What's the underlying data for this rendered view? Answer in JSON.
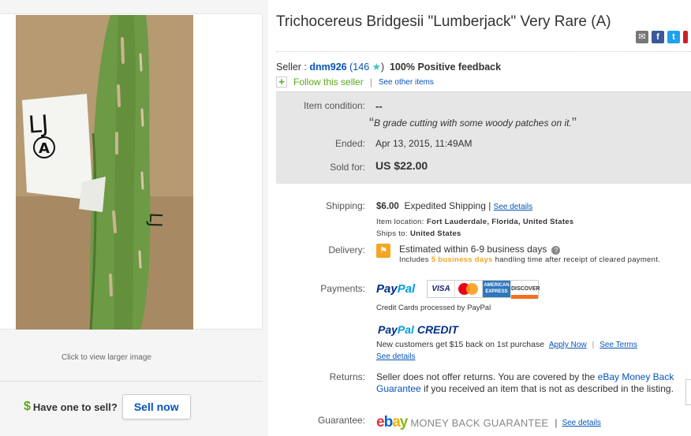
{
  "listing": {
    "title": "Trichocereus Bridgesii \"Lumberjack\" Very Rare (A)",
    "click_larger": "Click to view larger image",
    "photo_labels": {
      "card_top": "LJ",
      "card_circle": "A",
      "cactus": "LJ"
    }
  },
  "sell": {
    "dollar": "$",
    "question": "Have one to sell?",
    "button": "Sell now"
  },
  "share": {
    "icons": [
      "mail-icon",
      "facebook-icon",
      "twitter-icon",
      "pinterest-icon"
    ],
    "fb": "f",
    "tw": "t"
  },
  "seller": {
    "prefix": "Seller :",
    "name": "dnm926",
    "score_open": "(",
    "score": "146",
    "star": "★",
    "score_close": ")",
    "feedback_pct": "100%",
    "feedback_label": "Positive feedback",
    "follow_icon": "+",
    "follow": "Follow this seller",
    "separator": "|",
    "see_other": "See other items"
  },
  "item": {
    "condition_label": "Item condition:",
    "condition_value": "--",
    "condition_note_open": "“",
    "condition_note": "B grade cutting with some woody patches on it.",
    "condition_note_close": "”",
    "ended_label": "Ended:",
    "ended_value": "Apr 13, 2015, 11:49AM",
    "sold_label": "Sold for:",
    "sold_value": "US $22.00"
  },
  "shipping": {
    "label": "Shipping:",
    "price": "$6.00",
    "method": "Expedited Shipping |",
    "see_details": "See details",
    "location_label": "Item location:",
    "location_value": "Fort Lauderdale, Florida, United States",
    "ships_to_label": "Ships to:",
    "ships_to_value": "United States"
  },
  "delivery": {
    "label": "Delivery:",
    "icon": "⚑",
    "estimate": "Estimated within 6-9 business days",
    "help": "?",
    "includes": "Includes",
    "handling_days": "5 business days",
    "handling_rest": "handling time after receipt of cleared payment."
  },
  "payments": {
    "label": "Payments:",
    "paypal_a": "Pay",
    "paypal_b": "Pal",
    "cards": {
      "visa": "VISA",
      "mc": "MasterCard",
      "amex": "AMERICAN EXPRESS",
      "disc": "DISCOVER"
    },
    "cc_text": "Credit Cards processed by PayPal",
    "credit_a": "Pay",
    "credit_b": "Pal",
    "credit_c": "CREDIT",
    "new_customers": "New customers get $15 back on 1st purchase",
    "apply_now": "Apply Now",
    "sep": "|",
    "see_terms": "See Terms",
    "see_details": "See details"
  },
  "returns": {
    "label": "Returns:",
    "text_a": "Seller does not offer returns. You are covered by the",
    "link": "eBay Money Back Guarantee",
    "text_b": "if you received an item that is not as described in the listing."
  },
  "guarantee": {
    "label": "Guarantee:",
    "e": "e",
    "b": "b",
    "a": "a",
    "y": "y",
    "mbg": "MONEY BACK GUARANTEE",
    "sep": "|",
    "see_details": "See details"
  },
  "colors": {
    "link": "#0654ba",
    "green": "#5ba71b",
    "orange": "#f5a623",
    "panel": "#e6e6e6"
  }
}
